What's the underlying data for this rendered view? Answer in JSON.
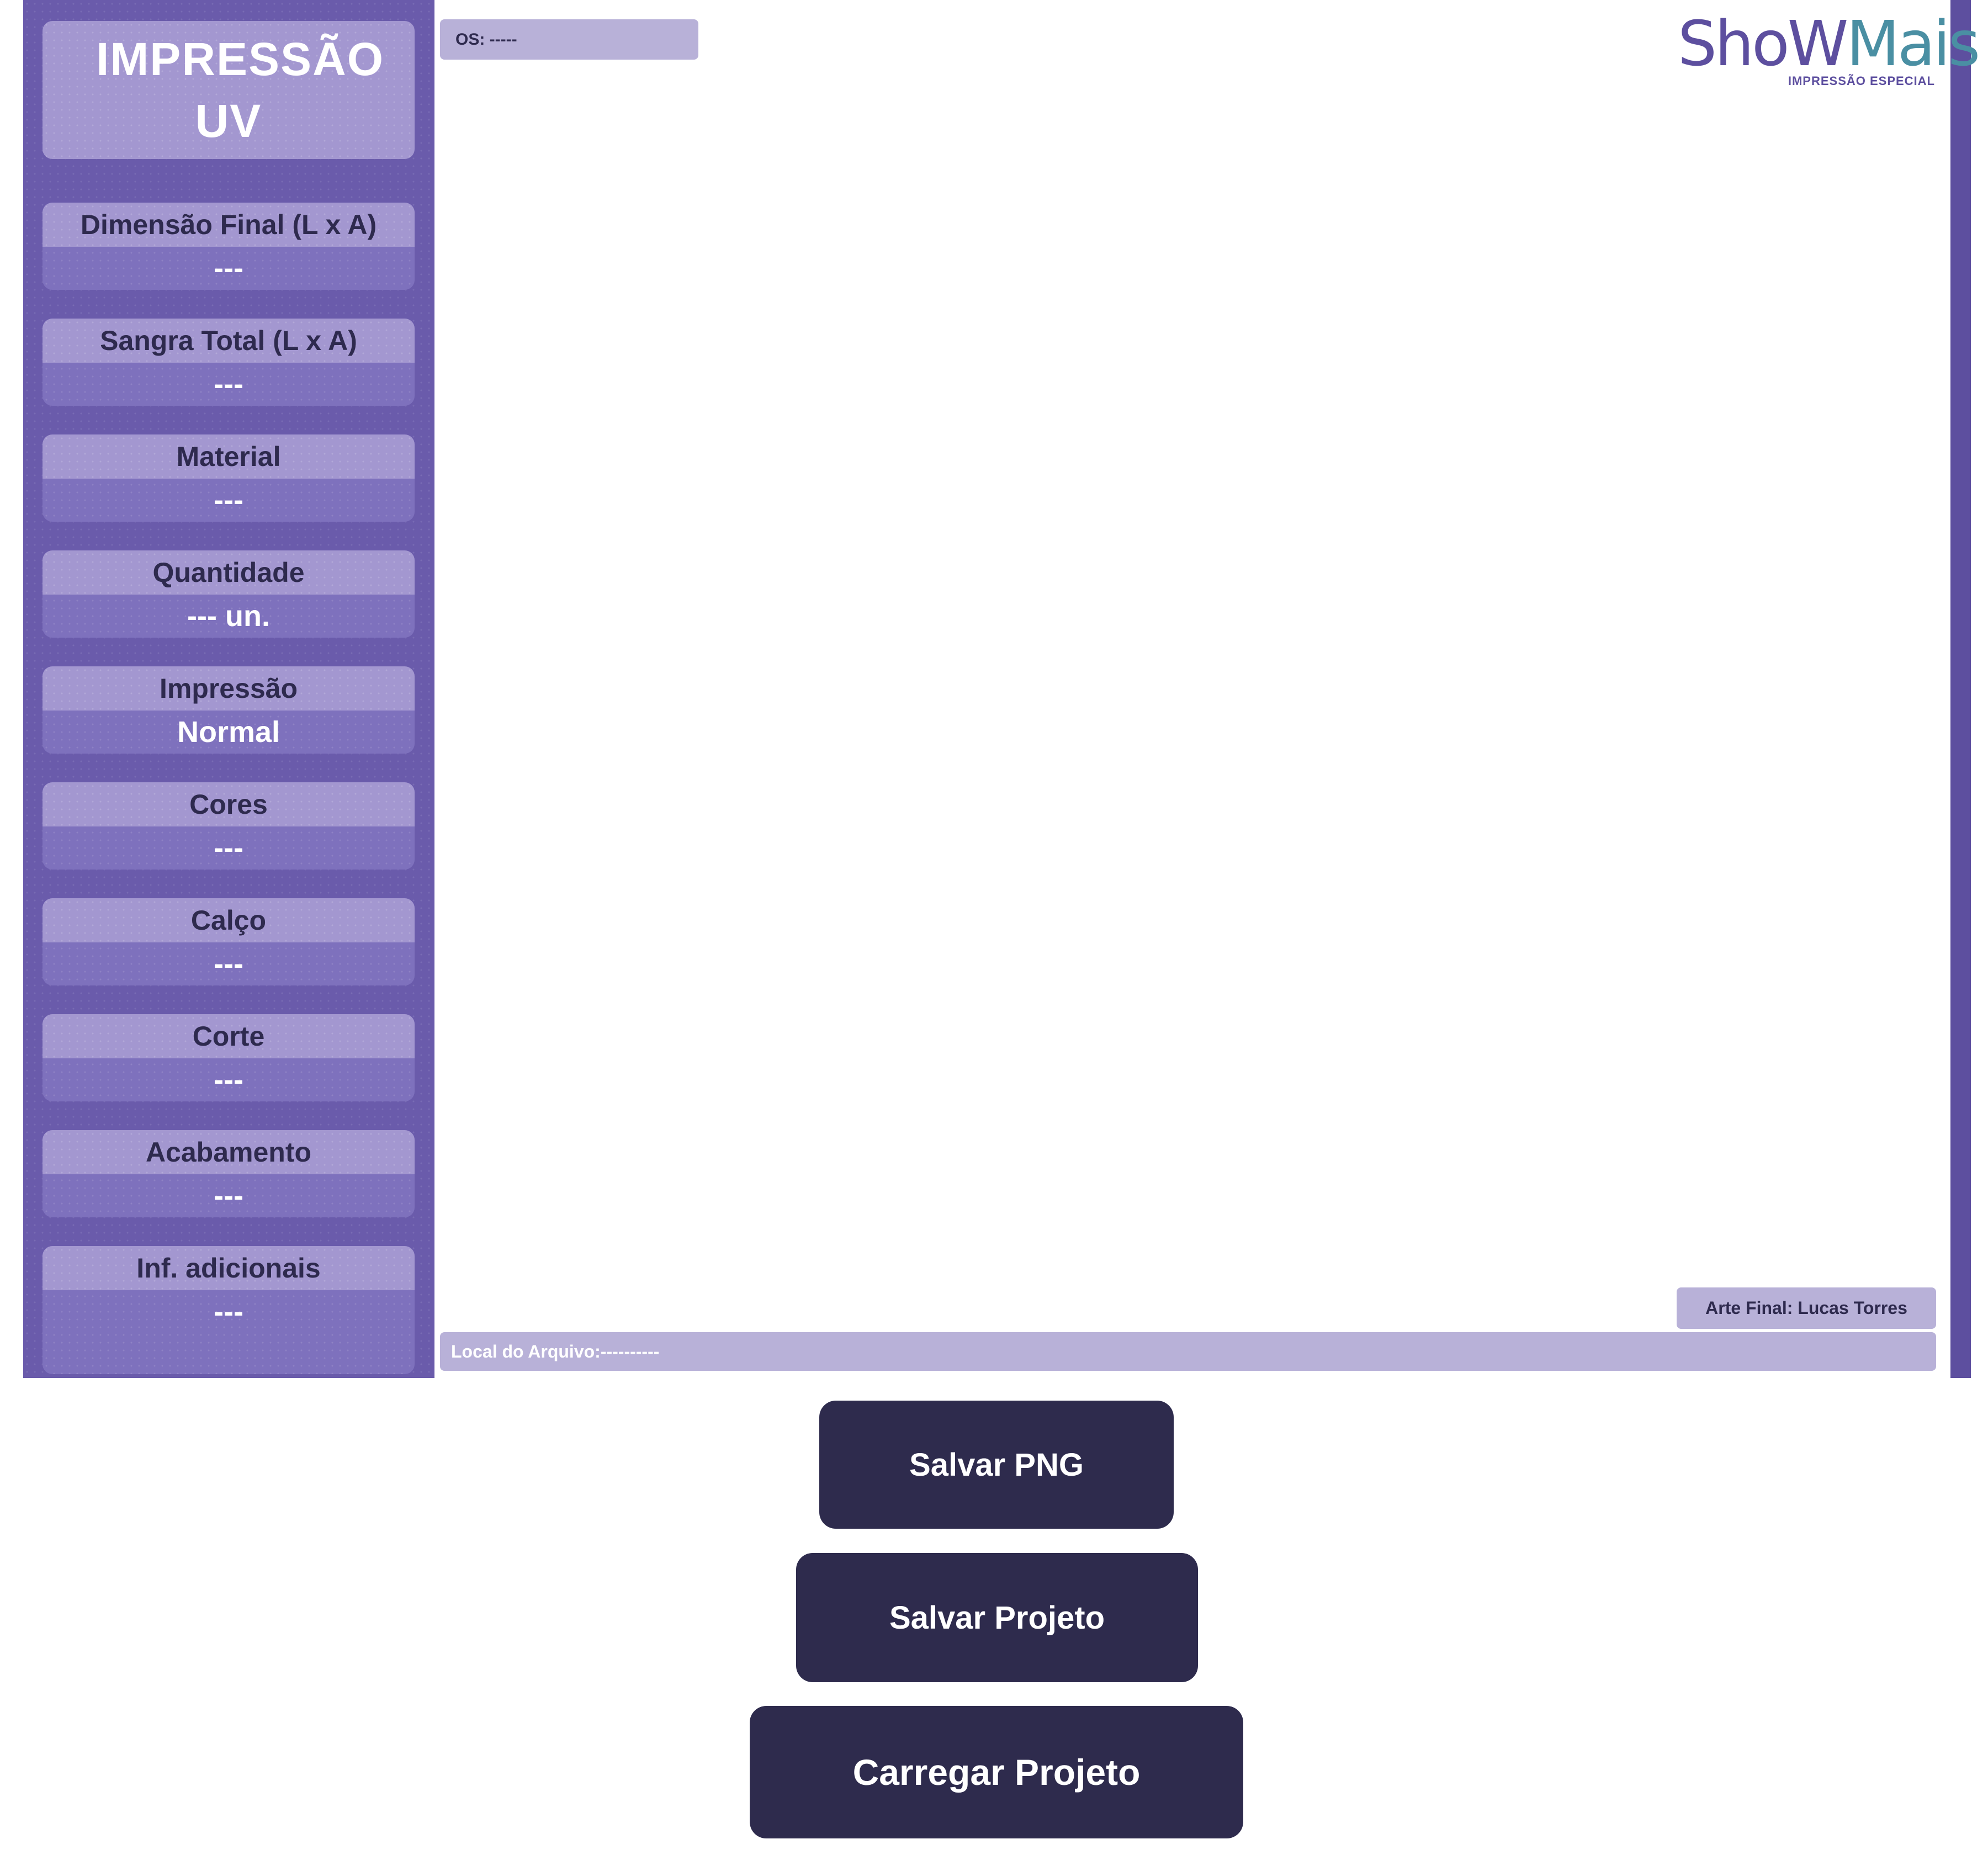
{
  "sidebar": {
    "title": "IMPRESSÃO UV",
    "specs": [
      {
        "label": "Dimensão Final (L x A)",
        "value": "---"
      },
      {
        "label": "Sangra Total (L x A)",
        "value": "---"
      },
      {
        "label": "Material",
        "value": "---"
      },
      {
        "label": "Quantidade",
        "value": "--- un."
      },
      {
        "label": "Impressão",
        "value": "Normal"
      },
      {
        "label": "Cores",
        "value": "---"
      },
      {
        "label": "Calço",
        "value": "---"
      },
      {
        "label": "Corte",
        "value": "---"
      },
      {
        "label": "Acabamento",
        "value": "---"
      },
      {
        "label": "Inf. adicionais",
        "value": "---"
      }
    ]
  },
  "canvas": {
    "os_label": "OS: -----",
    "logo": {
      "word_main": "ShoW",
      "word_tail": "Mais",
      "subtitle": "IMPRESSÃO ESPECIAL"
    },
    "arte_final": "Arte Final: Lucas Torres",
    "local_arquivo": "Local do Arquivo:----------"
  },
  "actions": {
    "save_png": "Salvar PNG",
    "save_project": "Salvar Projeto",
    "load_project": "Carregar Projeto"
  },
  "colors": {
    "frame": "#5d4f9f",
    "sidebar": "#6a5bab",
    "card_label": "#a397d0",
    "card_value": "#7e71bd",
    "pill": "#b8b1d8",
    "button": "#2e2b4d",
    "logo_accent": "#4a8fa3"
  }
}
